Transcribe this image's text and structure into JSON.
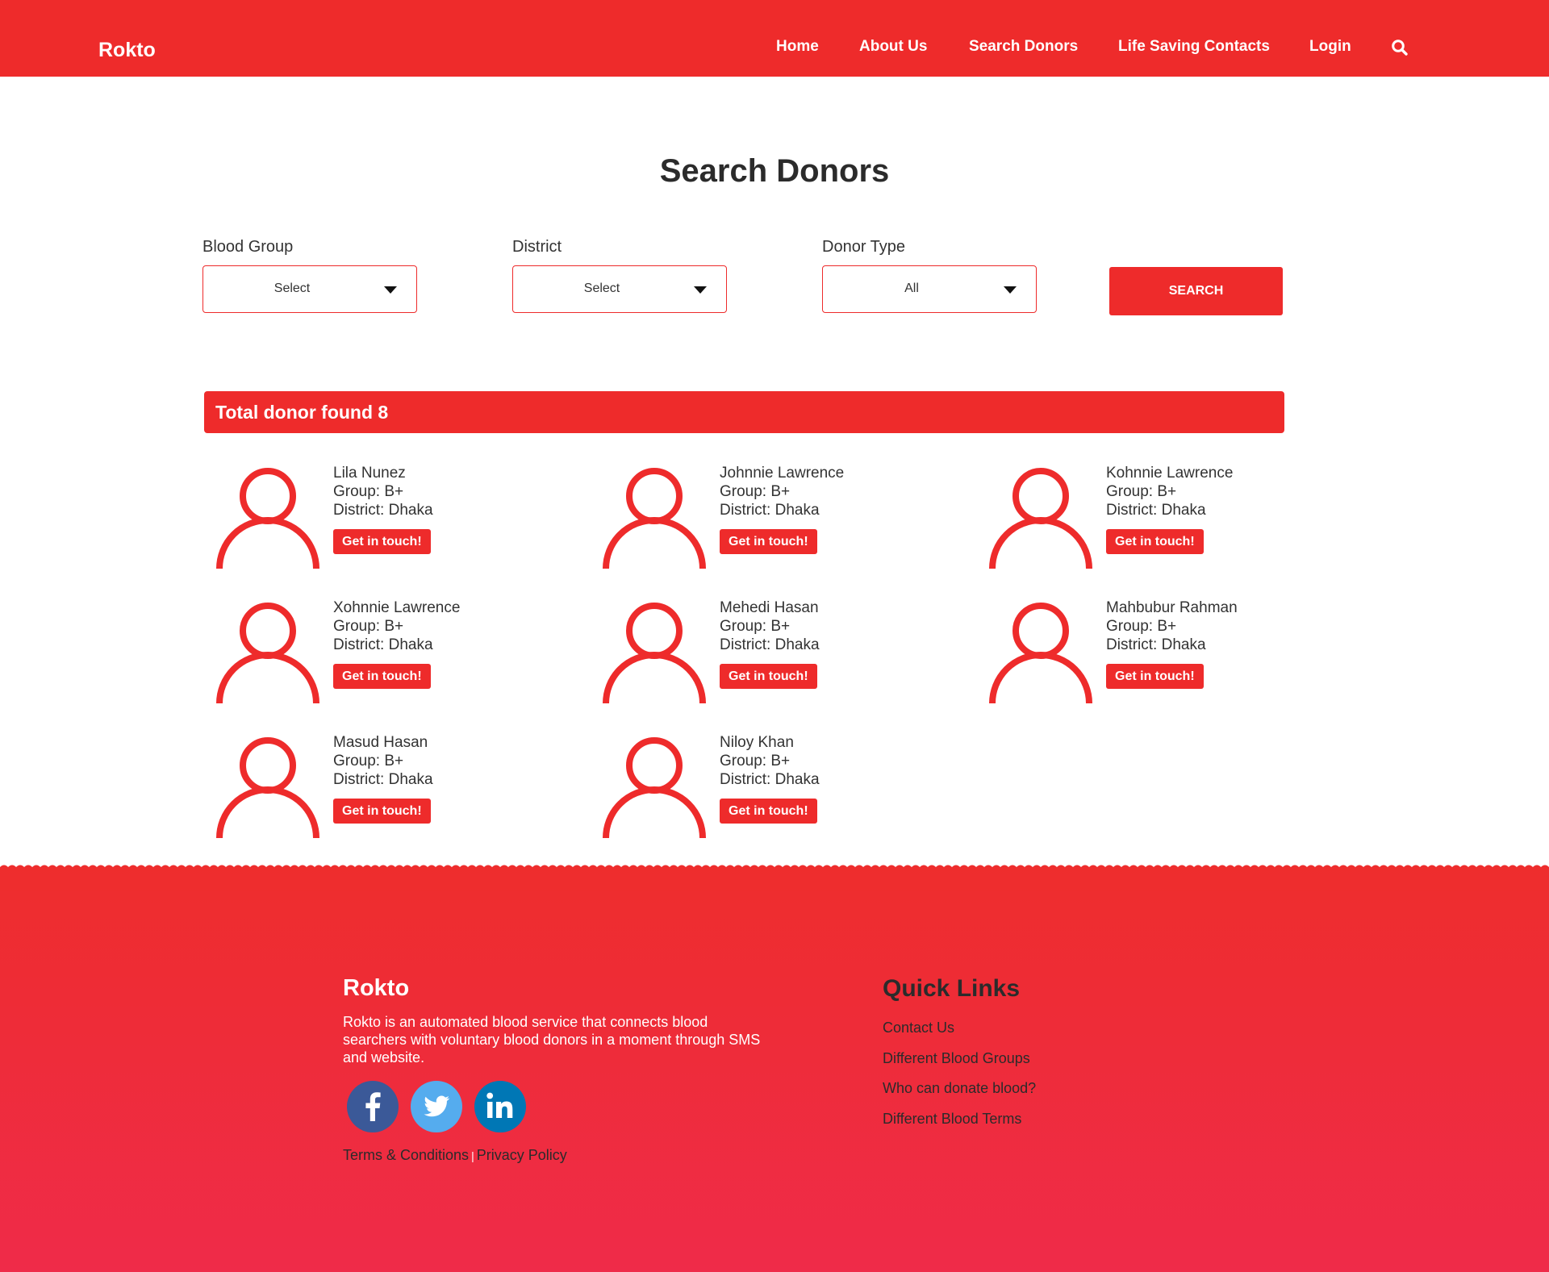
{
  "header": {
    "brand": "Rokto",
    "nav": [
      "Home",
      "About Us",
      "Search Donors",
      "Life Saving Contacts",
      "Login"
    ]
  },
  "page": {
    "title": "Search Donors"
  },
  "filters": {
    "blood_group": {
      "label": "Blood Group",
      "value": "Select"
    },
    "district": {
      "label": "District",
      "value": "Select"
    },
    "donor_type": {
      "label": "Donor Type",
      "value": "All"
    },
    "search_label": "SEARCH"
  },
  "results": {
    "total_text": "Total donor found 8",
    "cta_label": "Get in touch!",
    "donors": [
      {
        "name": "Lila Nunez",
        "group": "Group: B+",
        "district": "District: Dhaka"
      },
      {
        "name": "Johnnie Lawrence",
        "group": "Group: B+",
        "district": "District: Dhaka"
      },
      {
        "name": "Kohnnie Lawrence",
        "group": "Group: B+",
        "district": "District: Dhaka"
      },
      {
        "name": "Xohnnie Lawrence",
        "group": "Group: B+",
        "district": "District: Dhaka"
      },
      {
        "name": "Mehedi Hasan",
        "group": "Group: B+",
        "district": "District: Dhaka"
      },
      {
        "name": "Mahbubur Rahman",
        "group": "Group: B+",
        "district": "District: Dhaka"
      },
      {
        "name": "Masud Hasan",
        "group": "Group: B+",
        "district": "District: Dhaka"
      },
      {
        "name": "Niloy Khan",
        "group": "Group: B+",
        "district": "District: Dhaka"
      }
    ]
  },
  "footer": {
    "brand": "Rokto",
    "description": "Rokto is an automated blood service that connects blood searchers with voluntary blood donors in a moment through SMS and website.",
    "social": [
      {
        "icon": "facebook-icon",
        "color": "#3b5998"
      },
      {
        "icon": "twitter-icon",
        "color": "#55acee"
      },
      {
        "icon": "linkedin-icon",
        "color": "#0077b5"
      }
    ],
    "terms": "Terms & Conditions",
    "separator": "|",
    "privacy": "Privacy Policy",
    "quick_links_title": "Quick Links",
    "quick_links": [
      "Contact Us",
      "Different Blood Groups",
      "Who can donate blood?",
      "Different Blood Terms"
    ]
  },
  "colors": {
    "brand_red": "#ee2b2b",
    "footer_gradient_end": "#ef2b49"
  }
}
